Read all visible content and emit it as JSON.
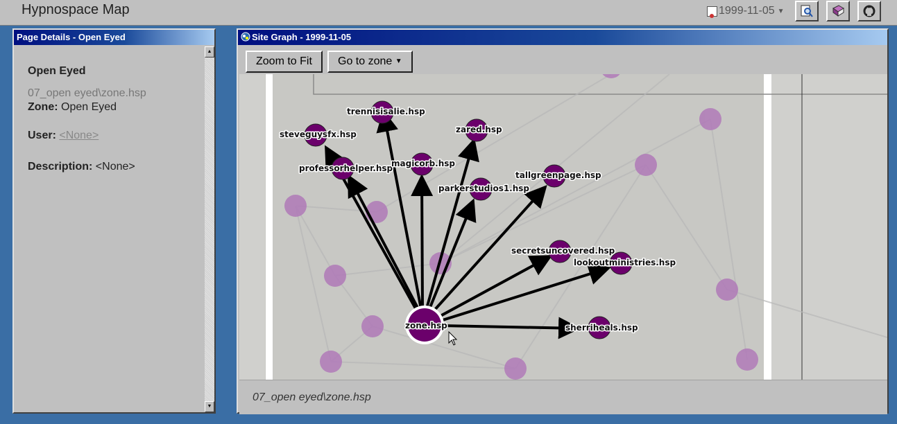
{
  "app": {
    "title": "Hypnospace Map",
    "date": "1999-11-05",
    "icons": [
      "search-page-icon",
      "book-icon",
      "github-icon"
    ]
  },
  "details": {
    "window_title": "Page Details - Open Eyed",
    "page_name": "Open Eyed",
    "path": "07_open eyed\\zone.hsp",
    "zone_label": "Zone:",
    "zone_value": "Open Eyed",
    "user_label": "User:",
    "user_value": "<None>",
    "description_label": "Description:",
    "description_value": "<None>"
  },
  "graph": {
    "window_title": "Site Graph - 1999-11-05",
    "zoom_button": "Zoom to Fit",
    "goto_button": "Go to zone",
    "footer_path": "07_open eyed\\zone.hsp",
    "center_node": "zone.hsp",
    "nodes": [
      "trennisisalie.hsp",
      "zared.hsp",
      "steveguysfx.hsp",
      "professorhelper.hsp",
      "magicorb.hsp",
      "parkerstudios1.hsp",
      "tallgreenpage.hsp",
      "secretsuncovered.hsp",
      "lookoutministries.hsp",
      "sherriheals.hsp"
    ],
    "colors": {
      "node_fill": "#6b006b",
      "faded_node": "#b07ab8",
      "edge": "#000000"
    }
  }
}
